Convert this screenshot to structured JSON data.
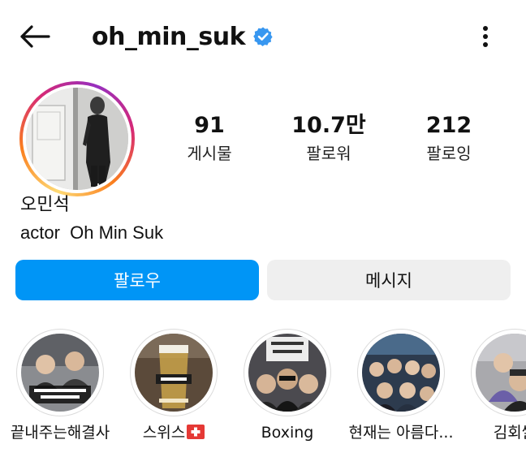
{
  "header": {
    "username": "oh_min_suk",
    "verified": true,
    "back_icon": "arrow-left-icon",
    "more_icon": "more-vertical-icon"
  },
  "profile": {
    "display_name": "오민석",
    "bio": "actor  Oh Min Suk"
  },
  "stats": [
    {
      "value": "91",
      "label": "게시물"
    },
    {
      "value": "10.7만",
      "label": "팔로워"
    },
    {
      "value": "212",
      "label": "팔로잉"
    }
  ],
  "actions": {
    "follow_label": "팔로우",
    "message_label": "메시지"
  },
  "highlights": [
    {
      "label": "끝내주는해결사"
    },
    {
      "label": "스위스",
      "flag": "swiss-flag-icon"
    },
    {
      "label": "Boxing"
    },
    {
      "label": "현재는 아름다..."
    },
    {
      "label": "김회쌀"
    }
  ],
  "colors": {
    "follow_button": "#0095f6",
    "message_button": "#efefef",
    "verified_badge": "#3897f0",
    "story_ring_start": "#feda75",
    "story_ring_end": "#962fbf"
  }
}
